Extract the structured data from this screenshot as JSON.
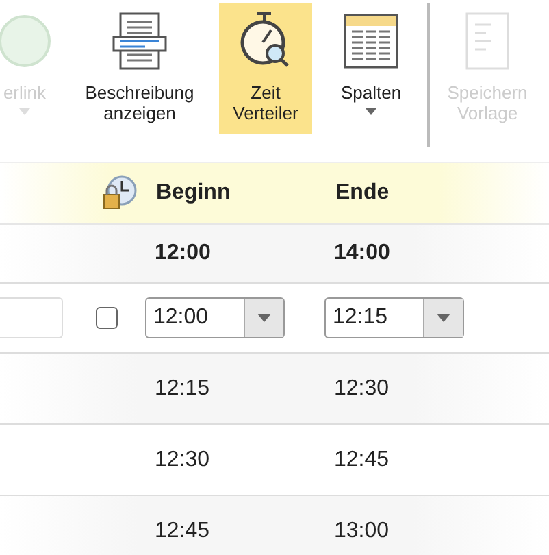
{
  "ribbon": {
    "items": [
      {
        "label": "erlink",
        "kind": "globe",
        "disabled": true,
        "selected": false,
        "caret": true
      },
      {
        "label": "Beschreibung anzeigen",
        "kind": "doc",
        "disabled": false,
        "selected": false,
        "caret": false
      },
      {
        "label": "Zeit Verteiler",
        "kind": "stopwatch",
        "disabled": false,
        "selected": true,
        "caret": false
      },
      {
        "label": "Spalten",
        "kind": "columns",
        "disabled": false,
        "selected": false,
        "caret": true
      },
      {
        "label": "Speichern Vorlage",
        "kind": "template",
        "disabled": true,
        "selected": false,
        "caret": false,
        "separator_before": true
      }
    ]
  },
  "table": {
    "columns": [
      "Beginn",
      "Ende"
    ],
    "rows": [
      {
        "kind": "summary",
        "begin": "12:00",
        "end": "14:00"
      },
      {
        "kind": "edit",
        "checked": false,
        "begin": "12:00",
        "end": "12:15"
      },
      {
        "kind": "plain",
        "begin": "12:15",
        "end": "12:30"
      },
      {
        "kind": "plain",
        "begin": "12:30",
        "end": "12:45"
      },
      {
        "kind": "plain",
        "begin": "12:45",
        "end": "13:00"
      }
    ]
  }
}
